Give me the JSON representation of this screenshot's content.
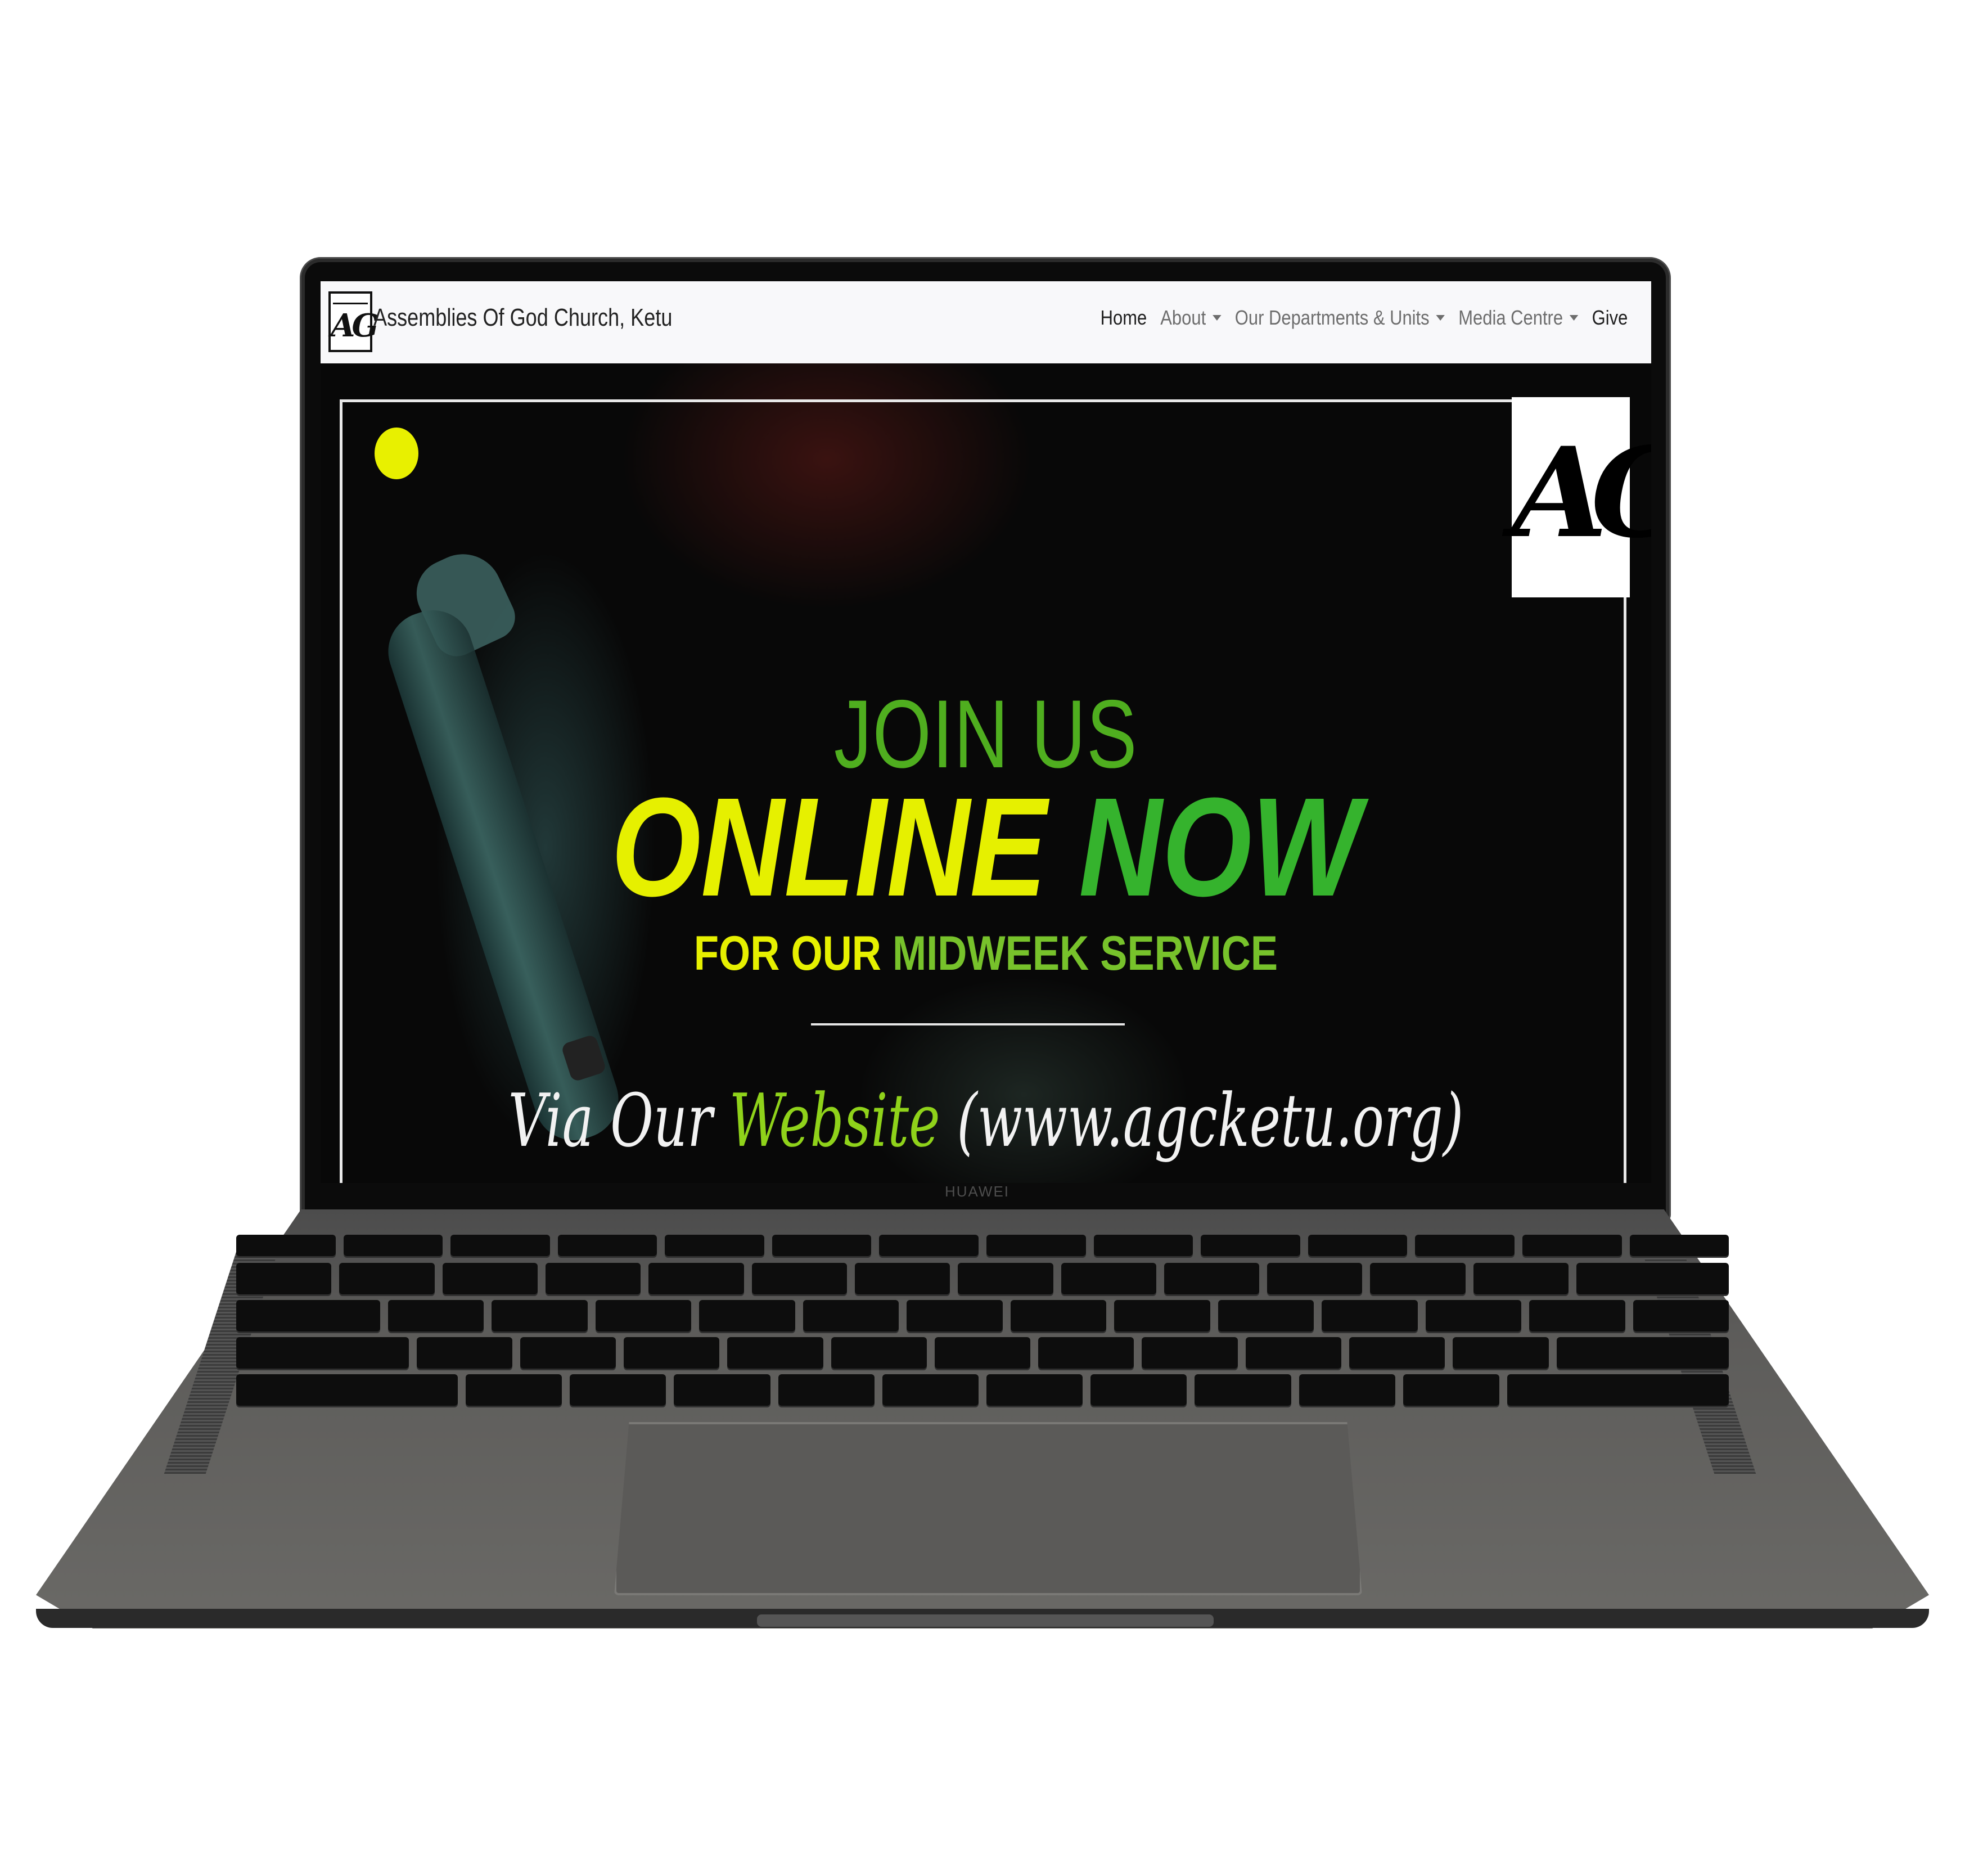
{
  "navbar": {
    "brand": "Assemblies Of God Church, Ketu",
    "logo_text": "AG",
    "menu": [
      {
        "label": "Home",
        "dropdown": false
      },
      {
        "label": "About",
        "dropdown": true
      },
      {
        "label": "Our Departments & Units",
        "dropdown": true
      },
      {
        "label": "Media Centre",
        "dropdown": true
      },
      {
        "label": "Give",
        "dropdown": false
      }
    ]
  },
  "hero": {
    "badge_text": "AG",
    "line1": "JOIN US",
    "line2_part1": "ONLINE",
    "line2_part2": "NOW",
    "line3_part1": "FOR OUR",
    "line3_part2": "MIDWEEK SERVICE",
    "script_part1": "Via Our",
    "script_part2": "Website",
    "script_part3": "(www.agcketu.org)"
  },
  "device": {
    "brand_label": "HUAWEI"
  },
  "colors": {
    "accent_yellow": "#e6f000",
    "accent_green": "#35b32d",
    "navbar_bg": "#f8f8fa"
  }
}
